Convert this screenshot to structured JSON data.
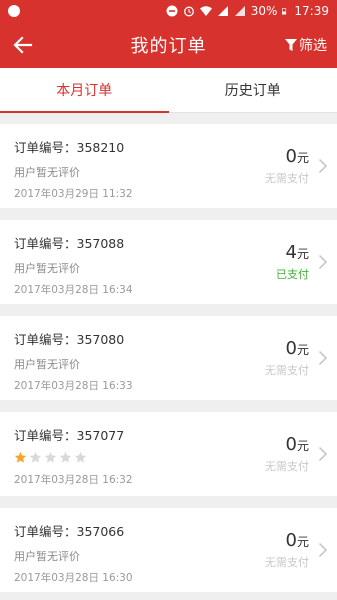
{
  "status_bar": {
    "battery": "30%",
    "time": "17:39"
  },
  "header": {
    "title": "我的订单",
    "filter_label": "筛选"
  },
  "tabs": [
    {
      "label": "本月订单",
      "active": true
    },
    {
      "label": "历史订单",
      "active": false
    }
  ],
  "orders": [
    {
      "order_no": "订单编号：358210",
      "review": "用户暂无评价",
      "rating": null,
      "date": "2017年03月29日 11:32",
      "amount": "0",
      "unit": "元",
      "pay_status": "无需支付",
      "paid": false
    },
    {
      "order_no": "订单编号：357088",
      "review": "用户暂无评价",
      "rating": null,
      "date": "2017年03月28日 16:34",
      "amount": "4",
      "unit": "元",
      "pay_status": "已支付",
      "paid": true
    },
    {
      "order_no": "订单编号：357080",
      "review": "用户暂无评价",
      "rating": null,
      "date": "2017年03月28日 16:33",
      "amount": "0",
      "unit": "元",
      "pay_status": "无需支付",
      "paid": false
    },
    {
      "order_no": "订单编号：357077",
      "review": "",
      "rating": 1,
      "date": "2017年03月28日 16:32",
      "amount": "0",
      "unit": "元",
      "pay_status": "无需支付",
      "paid": false
    },
    {
      "order_no": "订单编号：357066",
      "review": "用户暂无评价",
      "rating": null,
      "date": "2017年03月28日 16:30",
      "amount": "0",
      "unit": "元",
      "pay_status": "无需支付",
      "paid": false
    }
  ],
  "colors": {
    "brand": "#d8322e",
    "paid": "#3fb336",
    "star": "#f5a623"
  }
}
